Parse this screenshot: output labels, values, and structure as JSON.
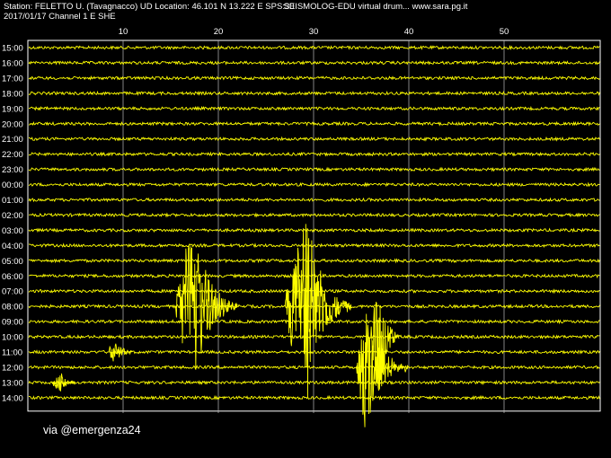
{
  "header": {
    "line1": "Station: FELETTO U. (Tavagnacco) UD Location:  46.101 N 13.222 E SPS:30",
    "line1b": "SEISMOLOG-EDU virtual drum... www.sara.pg.it",
    "line2": "2017/01/17  Channel 1 E SHE"
  },
  "minute_ticks": [
    "10",
    "20",
    "30",
    "40",
    "50"
  ],
  "hour_labels": [
    "15:00",
    "16:00",
    "17:00",
    "18:00",
    "19:00",
    "20:00",
    "21:00",
    "22:00",
    "23:00",
    "00:00",
    "01:00",
    "02:00",
    "03:00",
    "04:00",
    "05:00",
    "06:00",
    "07:00",
    "08:00",
    "09:00",
    "10:00",
    "11:00",
    "12:00",
    "13:00",
    "14:00"
  ],
  "caption": "via @emergenza24",
  "colors": {
    "trace": "#ffff00",
    "background": "#000000",
    "grid": "#ffffff",
    "text": "#ffffff"
  },
  "events": [
    {
      "hour_index": 17,
      "start_min": 15.5,
      "end_min": 22,
      "peak_min": 17.5,
      "amplitude": 5.5
    },
    {
      "hour_index": 17,
      "start_min": 27,
      "end_min": 34,
      "peak_min": 29.5,
      "amplitude": 6.2
    },
    {
      "hour_index": 19,
      "start_min": 36,
      "end_min": 39,
      "peak_min": 37,
      "amplitude": 4.2
    },
    {
      "hour_index": 20,
      "start_min": 8.5,
      "end_min": 11,
      "peak_min": 9.3,
      "amplitude": 0.9
    },
    {
      "hour_index": 21,
      "start_min": 34.5,
      "end_min": 40,
      "peak_min": 35.5,
      "amplitude": 4.5
    },
    {
      "hour_index": 22,
      "start_min": 2.5,
      "end_min": 5,
      "peak_min": 3.5,
      "amplitude": 0.6
    }
  ]
}
